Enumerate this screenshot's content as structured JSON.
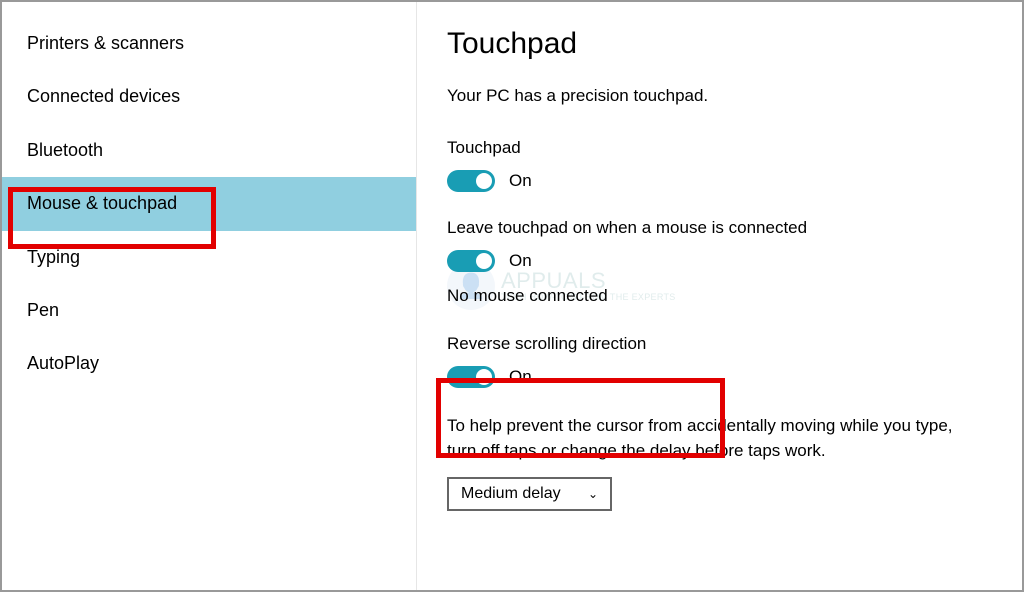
{
  "sidebar": {
    "items": [
      {
        "label": "Printers & scanners",
        "selected": false
      },
      {
        "label": "Connected devices",
        "selected": false
      },
      {
        "label": "Bluetooth",
        "selected": false
      },
      {
        "label": "Mouse & touchpad",
        "selected": true
      },
      {
        "label": "Typing",
        "selected": false
      },
      {
        "label": "Pen",
        "selected": false
      },
      {
        "label": "AutoPlay",
        "selected": false
      }
    ]
  },
  "main": {
    "title": "Touchpad",
    "subtitle": "Your PC has a precision touchpad.",
    "touchpad_toggle": {
      "label": "Touchpad",
      "state_label": "On",
      "on": true
    },
    "leave_on_toggle": {
      "label": "Leave touchpad on when a mouse is connected",
      "state_label": "On",
      "on": true
    },
    "mouse_status": "No mouse connected",
    "reverse_toggle": {
      "label": "Reverse scrolling direction",
      "state_label": "On",
      "on": true
    },
    "help_text": "To help prevent the cursor from accidentally moving while you type, turn off taps or change the delay before taps work.",
    "delay_dropdown": {
      "selected": "Medium delay"
    }
  },
  "watermark": {
    "title": "APPUALS",
    "sub": "TECH HOW-TO'S FROM THE EXPERTS"
  },
  "colors": {
    "accent": "#199db4",
    "highlight_red": "#e20000",
    "sidebar_selected": "#90cfe0"
  }
}
